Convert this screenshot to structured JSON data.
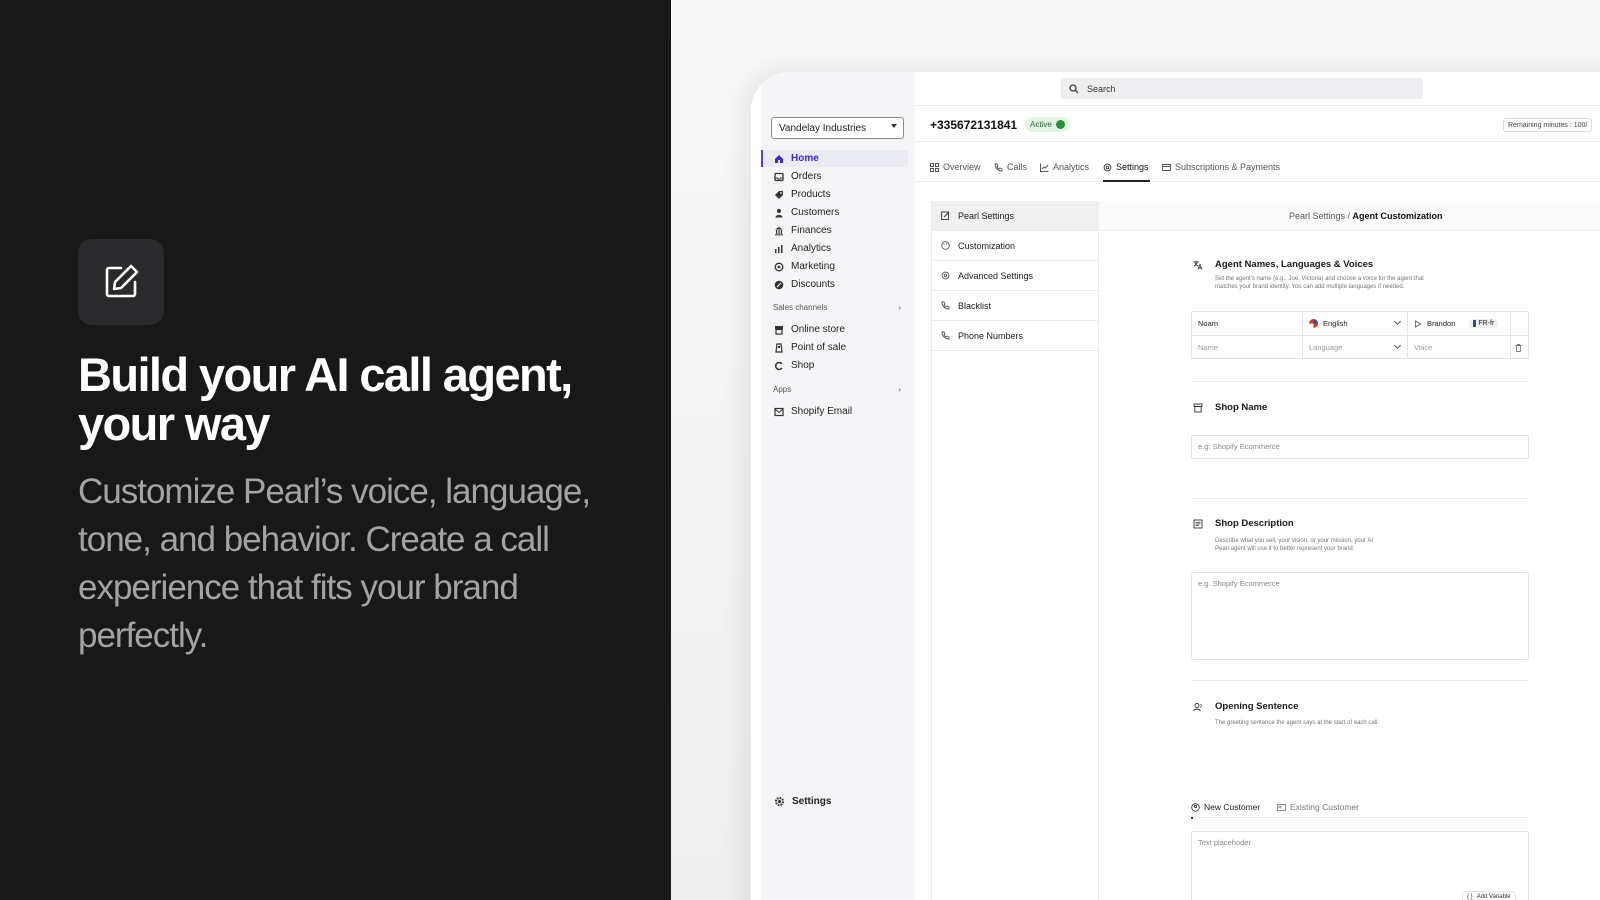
{
  "hero": {
    "title": "Build your AI call agent, your way",
    "subtitle": "Customize Pearl’s voice, language, tone, and behavior. Create a call experience that fits your brand perfectly."
  },
  "sidebar": {
    "store": "Vandelay Industries",
    "items": [
      {
        "label": "Home",
        "icon": "home-icon",
        "active": true
      },
      {
        "label": "Orders",
        "icon": "inbox-icon"
      },
      {
        "label": "Products",
        "icon": "tag-icon"
      },
      {
        "label": "Customers",
        "icon": "person-icon"
      },
      {
        "label": "Finances",
        "icon": "bank-icon"
      },
      {
        "label": "Analytics",
        "icon": "bar-chart-icon"
      },
      {
        "label": "Marketing",
        "icon": "target-icon"
      },
      {
        "label": "Discounts",
        "icon": "discount-icon"
      }
    ],
    "sales_channels_label": "Sales channels",
    "sales_channels": [
      {
        "label": "Online store",
        "icon": "storefront-icon"
      },
      {
        "label": "Point of sale",
        "icon": "pos-icon"
      },
      {
        "label": "Shop",
        "icon": "shop-icon"
      }
    ],
    "apps_label": "Apps",
    "apps": [
      {
        "label": "Shopify Email",
        "icon": "email-icon"
      }
    ],
    "settings_label": "Settings"
  },
  "topbar": {
    "search_placeholder": "Search"
  },
  "header": {
    "phone": "+335672131841",
    "status": "Active",
    "remaining": "Remaining minutes : 100/"
  },
  "tabs": [
    {
      "label": "Overview",
      "icon": "grid-icon"
    },
    {
      "label": "Calls",
      "icon": "phone-icon"
    },
    {
      "label": "Analytics",
      "icon": "line-chart-icon"
    },
    {
      "label": "Settings",
      "icon": "gear-icon",
      "active": true
    },
    {
      "label": "Subscriptions & Payments",
      "icon": "card-icon"
    }
  ],
  "settings_menu": [
    {
      "label": "Pearl Settings",
      "icon": "edit-icon",
      "selected": true
    },
    {
      "label": "Customization",
      "icon": "palette-icon"
    },
    {
      "label": "Advanced Settings",
      "icon": "gear-icon"
    },
    {
      "label": "Blacklist",
      "icon": "phone-block-icon"
    },
    {
      "label": "Phone Numbers",
      "icon": "phone-icon"
    }
  ],
  "breadcrumb": {
    "parent": "Pearl Settings",
    "separator": " / ",
    "current": "Agent Customization"
  },
  "agent_section": {
    "title": "Agent Names, Languages & Voices",
    "description": "Set the agent's name (e.g., Joe, Victoria) and choose a voice for the agent that matches your brand identity. You can add multiple languages if needed.",
    "row": {
      "name": "Noam",
      "language": "English",
      "voice": "Brandon",
      "locale": "FR-fr"
    },
    "placeholders": {
      "name": "Name",
      "language": "Language",
      "voice": "Voice"
    }
  },
  "shop_name": {
    "title": "Shop Name",
    "placeholder": "e.g. Shopify Ecommerce"
  },
  "shop_description": {
    "title": "Shop Description",
    "description": "Describe what you sell, your vision, or your mission, your AI Pearl agent will use it to better represent your brand.",
    "placeholder": "e.g. Shopify Ecommerce"
  },
  "opening_sentence": {
    "title": "Opening Sentence",
    "description": "The greeting sentence the agent says at the start of each call.",
    "tabs": [
      "New Customer",
      "Existing Customer"
    ],
    "placeholder": "Text placehoder",
    "add_variable": "Add Variable"
  }
}
